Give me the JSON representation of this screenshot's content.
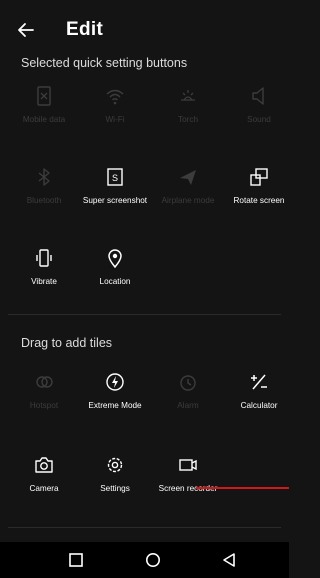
{
  "header": {
    "title": "Edit"
  },
  "sections": {
    "selected_title": "Selected quick setting buttons",
    "drag_title": "Drag to add tiles"
  },
  "selected_tiles": [
    {
      "label": "Mobile data",
      "icon": "mobile-data-icon",
      "enabled": false
    },
    {
      "label": "Wi-Fi",
      "icon": "wifi-icon",
      "enabled": false
    },
    {
      "label": "Torch",
      "icon": "torch-icon",
      "enabled": false
    },
    {
      "label": "Sound",
      "icon": "sound-icon",
      "enabled": false
    },
    {
      "label": "Bluetooth",
      "icon": "bluetooth-icon",
      "enabled": false
    },
    {
      "label": "Super screenshot",
      "icon": "super-screenshot-icon",
      "enabled": true
    },
    {
      "label": "Airplane mode",
      "icon": "airplane-icon",
      "enabled": false
    },
    {
      "label": "Rotate screen",
      "icon": "rotate-screen-icon",
      "enabled": true
    },
    {
      "label": "Vibrate",
      "icon": "vibrate-icon",
      "enabled": true
    },
    {
      "label": "Location",
      "icon": "location-icon",
      "enabled": true
    }
  ],
  "available_tiles": [
    {
      "label": "Hotspot",
      "icon": "hotspot-icon",
      "enabled": false
    },
    {
      "label": "Extreme Mode",
      "icon": "extreme-mode-icon",
      "enabled": true
    },
    {
      "label": "Alarm",
      "icon": "alarm-icon",
      "enabled": false
    },
    {
      "label": "Calculator",
      "icon": "calculator-icon",
      "enabled": true
    },
    {
      "label": "Camera",
      "icon": "camera-icon",
      "enabled": true
    },
    {
      "label": "Settings",
      "icon": "settings-icon",
      "enabled": true
    },
    {
      "label": "Screen recorder",
      "icon": "screen-recorder-icon",
      "enabled": true
    }
  ],
  "navbar": {
    "items": [
      "recents-icon",
      "home-icon",
      "back-icon"
    ]
  },
  "colors": {
    "background": "#141414",
    "text": "#ffffff",
    "disabled": "#3c3c3c",
    "indicator": "#d01818"
  }
}
